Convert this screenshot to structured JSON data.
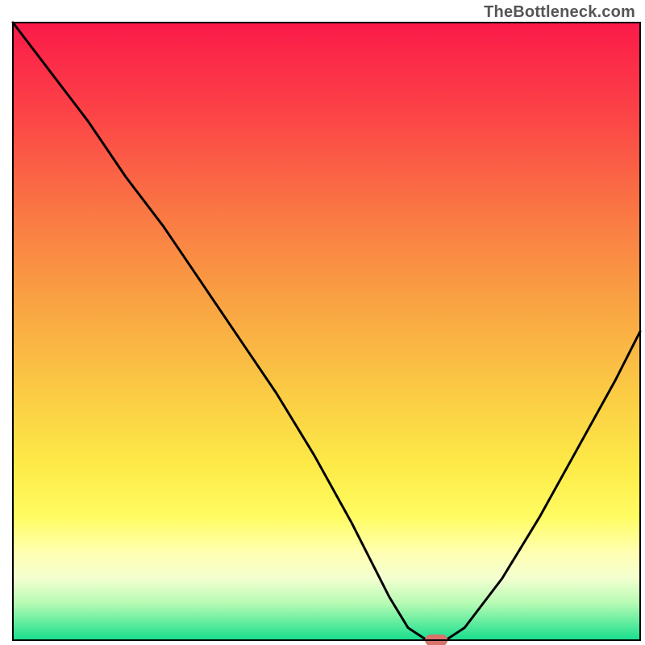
{
  "watermark": "TheBottleneck.com",
  "chart_data": {
    "type": "line",
    "title": "",
    "xlabel": "",
    "ylabel": "",
    "xlim": [
      0,
      100
    ],
    "ylim": [
      0,
      100
    ],
    "grid": false,
    "legend": false,
    "series": [
      {
        "name": "bottleneck-curve",
        "x": [
          0,
          6,
          12,
          18,
          24,
          30,
          36,
          42,
          48,
          54,
          60,
          63,
          66,
          69,
          72,
          78,
          84,
          90,
          96,
          100
        ],
        "y": [
          100,
          92,
          84,
          75,
          67,
          58,
          49,
          40,
          30,
          19,
          7,
          2,
          0,
          0,
          2,
          10,
          20,
          31,
          42,
          50
        ]
      }
    ],
    "marker": {
      "name": "optimal-point",
      "x": 67.5,
      "y": 0,
      "color": "#d8746b",
      "shape": "pill"
    },
    "background_gradient": {
      "stops": [
        {
          "pos": 0.0,
          "color": "#fb1a49"
        },
        {
          "pos": 0.15,
          "color": "#fc4447"
        },
        {
          "pos": 0.3,
          "color": "#fa7544"
        },
        {
          "pos": 0.45,
          "color": "#f9a243"
        },
        {
          "pos": 0.6,
          "color": "#fbcb44"
        },
        {
          "pos": 0.72,
          "color": "#fdeb48"
        },
        {
          "pos": 0.8,
          "color": "#fffc62"
        },
        {
          "pos": 0.86,
          "color": "#ffffb4"
        },
        {
          "pos": 0.9,
          "color": "#f3ffd0"
        },
        {
          "pos": 0.94,
          "color": "#b7fbb4"
        },
        {
          "pos": 0.97,
          "color": "#66eda0"
        },
        {
          "pos": 1.0,
          "color": "#16de8c"
        }
      ]
    },
    "frame": {
      "outer_margin_left": 16,
      "outer_margin_top": 28,
      "outer_margin_right": 6,
      "outer_margin_bottom": 6,
      "frame_stroke": "#000000",
      "frame_stroke_width": 2
    }
  }
}
